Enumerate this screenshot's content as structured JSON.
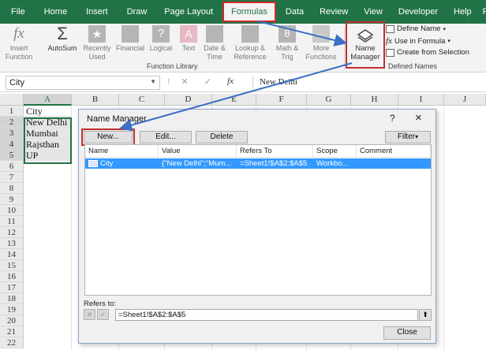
{
  "ribbon": {
    "tabs": [
      "File",
      "Home",
      "Insert",
      "Draw",
      "Page Layout",
      "Formulas",
      "Data",
      "Review",
      "View",
      "Developer",
      "Help",
      "Pow"
    ],
    "active_tab": "Formulas",
    "buttons": {
      "insert_function": "Insert Function",
      "insert_function_glyph": "fx",
      "autosum": "AutoSum",
      "recently_used": "Recently Used",
      "financial": "Financial",
      "logical": "Logical",
      "text": "Text",
      "date_time": "Date & Time",
      "lookup_reference": "Lookup & Reference",
      "math_trig": "Math & Trig",
      "more_functions": "More Functions",
      "name_manager": "Name Manager"
    },
    "group_function_library": "Function Library",
    "group_defined_names": "Defined Names",
    "define_name": "Define Name",
    "use_in_formula": "Use in Formula",
    "create_from_selection": "Create from Selection"
  },
  "formula_bar": {
    "name_box": "City",
    "fx_glyph": "fx",
    "value": "New Delhi"
  },
  "grid": {
    "columns": [
      "A",
      "B",
      "C",
      "D",
      "E",
      "F",
      "G",
      "H",
      "I",
      "J"
    ],
    "rows": [
      "1",
      "2",
      "3",
      "4",
      "5",
      "6",
      "7",
      "8",
      "9",
      "10",
      "11",
      "12",
      "13",
      "14",
      "15",
      "16",
      "17",
      "18",
      "19",
      "20",
      "21",
      "22"
    ],
    "cells": [
      "City",
      "New Delhi",
      "Mumbai",
      "Rajsthan",
      "UP"
    ]
  },
  "dialog": {
    "title": "Name Manager",
    "help": "?",
    "close": "×",
    "buttons": {
      "new": "New...",
      "edit": "Edit...",
      "delete": "Delete",
      "filter": "Filter"
    },
    "headers": [
      "Name",
      "Value",
      "Refers To",
      "Scope",
      "Comment"
    ],
    "row": {
      "name": "City",
      "value": "{\"New Delhi\";\"Mum...",
      "refers_to": "=Sheet1!$A$2:$A$5",
      "scope": "Workbo...",
      "comment": ""
    },
    "refers_to_label": "Refers to:",
    "refers_to_value": "=Sheet1!$A$2:$A$5",
    "close_button": "Close"
  },
  "colors": {
    "excel_green": "#217346",
    "highlight_red": "#c0302f",
    "arrow_blue": "#3a6fc4",
    "selection_blue": "#3399ff"
  }
}
